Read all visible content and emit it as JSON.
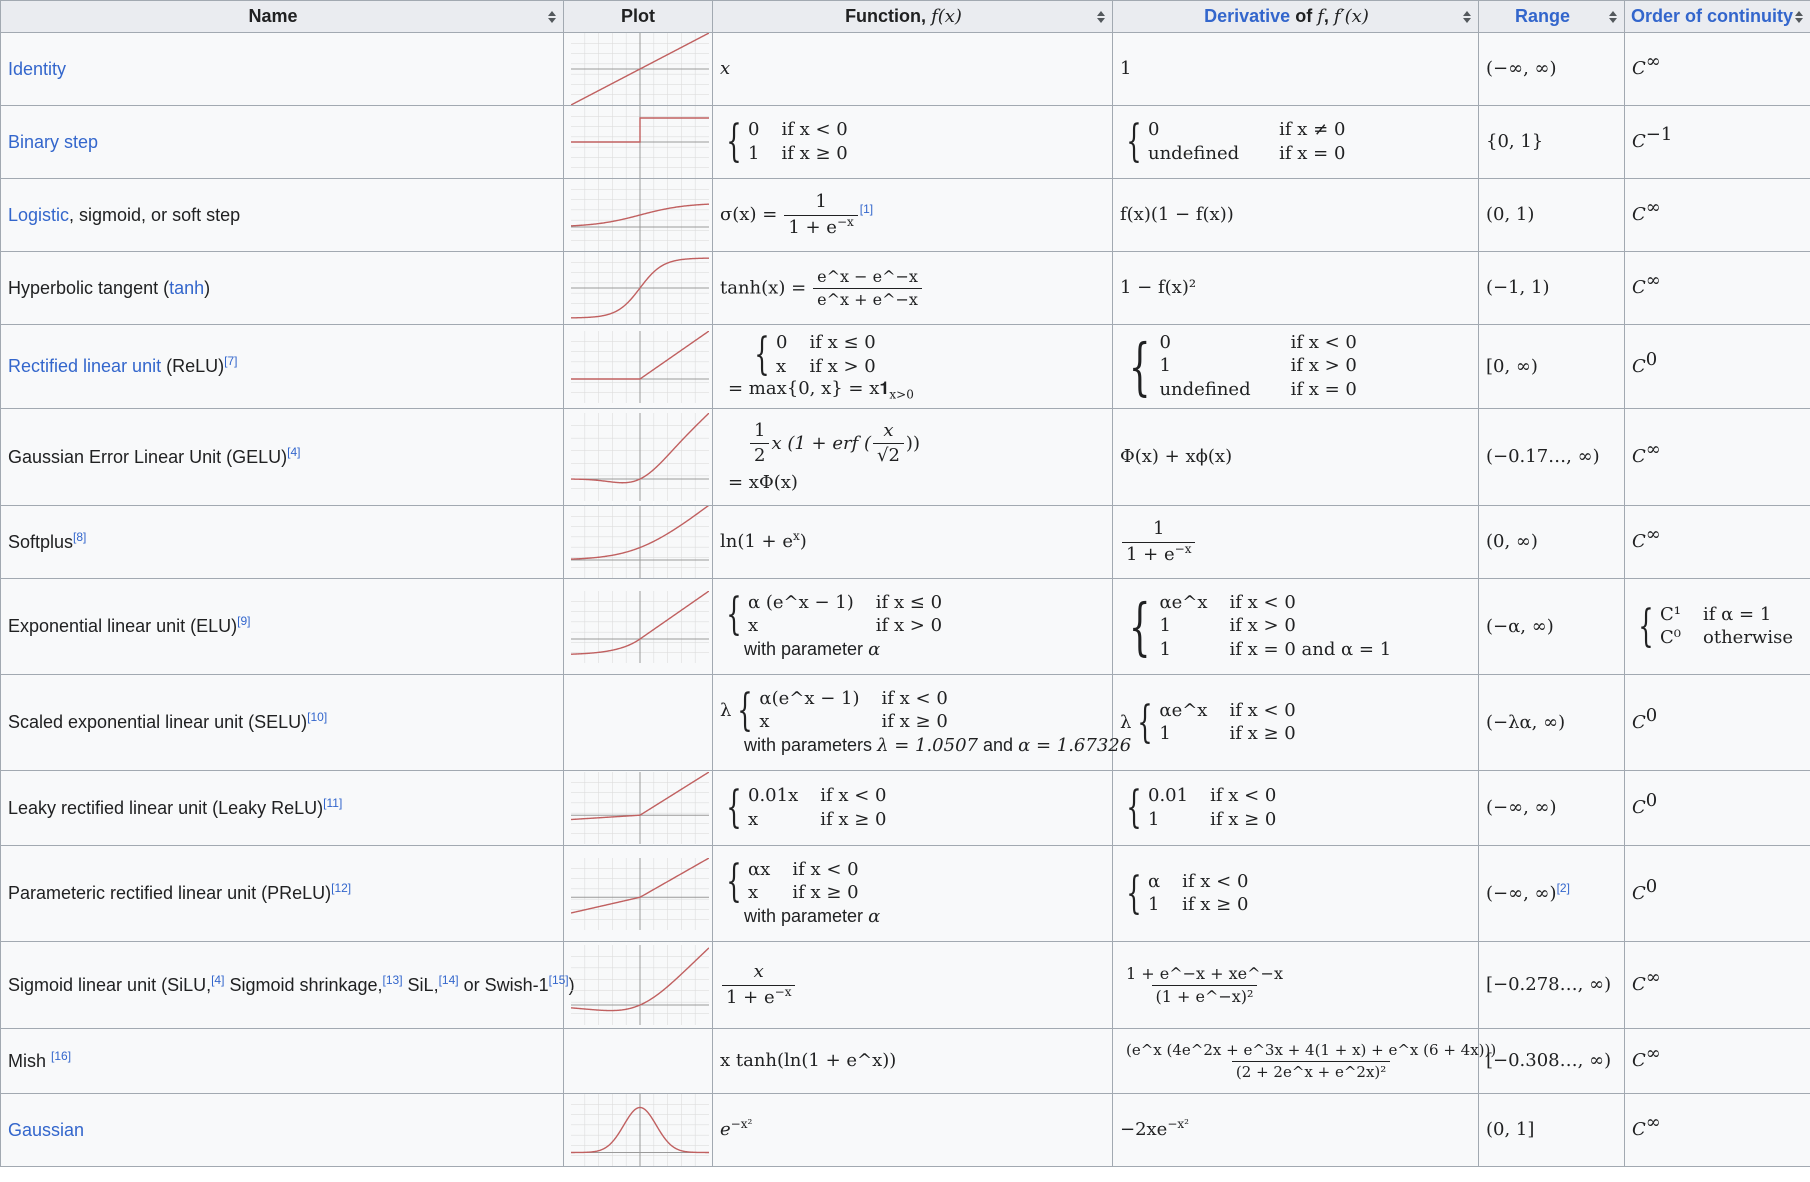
{
  "headers": {
    "name": "Name",
    "plot": "Plot",
    "function_label": "Function,",
    "function_sym": "f(x)",
    "derivative_link": "Derivative",
    "derivative_mid": "of",
    "derivative_f": "f",
    "derivative_sym": "f′(x)",
    "range": "Range",
    "continuity": "Order of continuity"
  },
  "rows": [
    {
      "key": "identity",
      "name_link": "Identity",
      "func": "x",
      "deriv": "1",
      "range": "(−∞, ∞)",
      "cont": "C",
      "cont_sup": "∞",
      "plot": "identity"
    },
    {
      "key": "binary",
      "name_link": "Binary step",
      "case1_a": "0",
      "case1_b": "if x < 0",
      "case2_a": "1",
      "case2_b": "if x ≥ 0",
      "d1_a": "0",
      "d1_b": "if x ≠ 0",
      "d2_a": "undefined",
      "d2_b": "if x = 0",
      "range": "{0, 1}",
      "cont": "C",
      "cont_sup": "−1",
      "plot": "step"
    },
    {
      "key": "logistic",
      "name_link": "Logistic",
      "name_rest": ", sigmoid, or soft step",
      "func_pre": "σ(x) =",
      "num": "1",
      "den": "1 + e",
      "den_sup": "−x",
      "ref": "[1]",
      "deriv": "f(x)(1 − f(x))",
      "range": "(0, 1)",
      "cont": "C",
      "cont_sup": "∞",
      "plot": "logistic"
    },
    {
      "key": "tanh",
      "name_pre": "Hyperbolic tangent (",
      "name_link": "tanh",
      "name_post": ")",
      "func_pre": "tanh(x) =",
      "num": "e^x − e^−x",
      "den": "e^x + e^−x",
      "deriv": "1 − f(x)²",
      "range": "(−1, 1)",
      "cont": "C",
      "cont_sup": "∞",
      "plot": "tanh"
    },
    {
      "key": "relu",
      "name_link": "Rectified linear unit",
      "name_rest": " (ReLU)",
      "ref": "[7]",
      "case1_a": "0",
      "case1_b": "if x ≤ 0",
      "case2_a": "x",
      "case2_b": "if x > 0",
      "eq": "= max{0, x} = x𝟏",
      "eq_sub": "x>0",
      "d1_a": "0",
      "d1_b": "if x < 0",
      "d2_a": "1",
      "d2_b": "if x > 0",
      "d3_a": "undefined",
      "d3_b": "if x = 0",
      "range": "[0, ∞)",
      "cont": "C",
      "cont_sup": "0",
      "plot": "relu"
    },
    {
      "key": "gelu",
      "name": "Gaussian Error Linear Unit (GELU)",
      "ref": "[4]",
      "f_half_num": "1",
      "f_half_den": "2",
      "f_line": "x (1 + erf (",
      "f_xnum": "x",
      "f_xden": "√2",
      "f_close": "))",
      "eq": "= xΦ(x)",
      "deriv": "Φ(x) + xϕ(x)",
      "range": "(−0.17…, ∞)",
      "cont": "C",
      "cont_sup": "∞",
      "plot": "gelu"
    },
    {
      "key": "softplus",
      "name": "Softplus",
      "ref": "[8]",
      "func": "ln(1 + e",
      "func_sup": "x",
      "func_close": ")",
      "dnum": "1",
      "dden": "1 + e",
      "dden_sup": "−x",
      "range": "(0, ∞)",
      "cont": "C",
      "cont_sup": "∞",
      "plot": "softplus"
    },
    {
      "key": "elu",
      "name": "Exponential linear unit (ELU)",
      "ref": "[9]",
      "case1_a": "α (e^x − 1)",
      "case1_b": "if x ≤ 0",
      "case2_a": "x",
      "case2_b": "if x > 0",
      "note": "with parameter",
      "note_sym": "α",
      "d1_a": "αe^x",
      "d1_b": "if x < 0",
      "d2_a": "1",
      "d2_b": "if x > 0",
      "d3_a": "1",
      "d3_b": "if x = 0 and α = 1",
      "range": "(−α, ∞)",
      "c1_a": "C¹",
      "c1_b": "if α = 1",
      "c2_a": "C⁰",
      "c2_b": "otherwise",
      "plot": "elu"
    },
    {
      "key": "selu",
      "name": "Scaled exponential linear unit (SELU)",
      "ref": "[10]",
      "lam": "λ",
      "case1_a": "α(e^x − 1)",
      "case1_b": "if x < 0",
      "case2_a": "x",
      "case2_b": "if x ≥ 0",
      "note": "with parameters",
      "note_sym1": "λ = 1.0507",
      "note_and": "and",
      "note_sym2": "α = 1.67326",
      "d1_a": "αe^x",
      "d1_b": "if x < 0",
      "d2_a": "1",
      "d2_b": "if x ≥ 0",
      "range": "(−λα, ∞)",
      "cont": "C",
      "cont_sup": "0"
    },
    {
      "key": "leaky",
      "name": "Leaky rectified linear unit (Leaky ReLU)",
      "ref": "[11]",
      "case1_a": "0.01x",
      "case1_b": "if x < 0",
      "case2_a": "x",
      "case2_b": "if x ≥ 0",
      "d1_a": "0.01",
      "d1_b": "if x < 0",
      "d2_a": "1",
      "d2_b": "if x ≥ 0",
      "range": "(−∞, ∞)",
      "cont": "C",
      "cont_sup": "0",
      "plot": "leaky"
    },
    {
      "key": "prelu",
      "name": "Parameteric rectified linear unit (PReLU)",
      "ref": "[12]",
      "case1_a": "αx",
      "case1_b": "if x < 0",
      "case2_a": "x",
      "case2_b": "if x ≥ 0",
      "note": "with parameter",
      "note_sym": "α",
      "d1_a": "α",
      "d1_b": "if x < 0",
      "d2_a": "1",
      "d2_b": "if x ≥ 0",
      "range": "(−∞, ∞)",
      "range_ref": "[2]",
      "cont": "C",
      "cont_sup": "0",
      "plot": "prelu"
    },
    {
      "key": "silu",
      "name_a": "Sigmoid linear unit (SiLU,",
      "ref_a": "[4]",
      "name_b": " Sigmoid shrinkage,",
      "ref_b": "[13]",
      "name_c": " SiL,",
      "ref_c": "[14]",
      "name_d": " or Swish-1",
      "ref_d": "[15]",
      "name_e": ")",
      "num": "x",
      "den": "1 + e",
      "den_sup": "−x",
      "dnum": "1 + e^−x + xe^−x",
      "dden": "(1 + e^−x)²",
      "range": "[−0.278…, ∞)",
      "cont": "C",
      "cont_sup": "∞",
      "plot": "silu"
    },
    {
      "key": "mish",
      "name": "Mish ",
      "ref": "[16]",
      "func": "x tanh(ln(1 + e^x))",
      "dnum": "(e^x (4e^2x + e^3x + 4(1 + x) + e^x (6 + 4x)))",
      "dden": "(2 + 2e^x + e^2x)²",
      "range": "[−0.308…, ∞)",
      "cont": "C",
      "cont_sup": "∞"
    },
    {
      "key": "gaussian",
      "name_link": "Gaussian",
      "func": "e",
      "func_sup": "−x²",
      "deriv": "−2xe",
      "deriv_sup": "−x²",
      "range": "(0, 1]",
      "cont": "C",
      "cont_sup": "∞",
      "plot": "gaussian"
    }
  ],
  "colors": {
    "link": "#3366cc",
    "curve": "#c06060",
    "grid": "#dddddd",
    "axis": "#9a9a9a"
  }
}
